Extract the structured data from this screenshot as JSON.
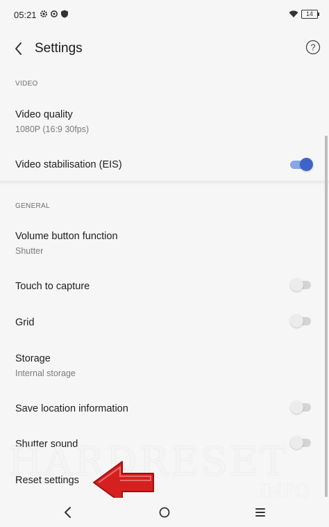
{
  "status_bar": {
    "time": "05:21",
    "battery": "14"
  },
  "app_bar": {
    "title": "Settings"
  },
  "sections": {
    "video": {
      "title": "VIDEO",
      "video_quality": {
        "label": "Video quality",
        "value": "1080P (16:9  30fps)"
      },
      "video_stabilisation": {
        "label": "Video stabilisation (EIS)",
        "enabled": true
      }
    },
    "general": {
      "title": "GENERAL",
      "volume_button": {
        "label": "Volume button function",
        "value": "Shutter"
      },
      "touch_capture": {
        "label": "Touch to capture",
        "enabled": false
      },
      "grid": {
        "label": "Grid",
        "enabled": false
      },
      "storage": {
        "label": "Storage",
        "value": "Internal storage"
      },
      "save_location": {
        "label": "Save location information",
        "enabled": false
      },
      "shutter_sound": {
        "label": "Shutter sound",
        "enabled": false
      },
      "reset": {
        "label": "Reset settings"
      }
    }
  },
  "watermark": {
    "main": "HARDRESET",
    "sub": ".INFO"
  },
  "colors": {
    "accent": "#3e64c8",
    "toggle_on_track": "#87a7e6",
    "arrow": "#d62020"
  }
}
